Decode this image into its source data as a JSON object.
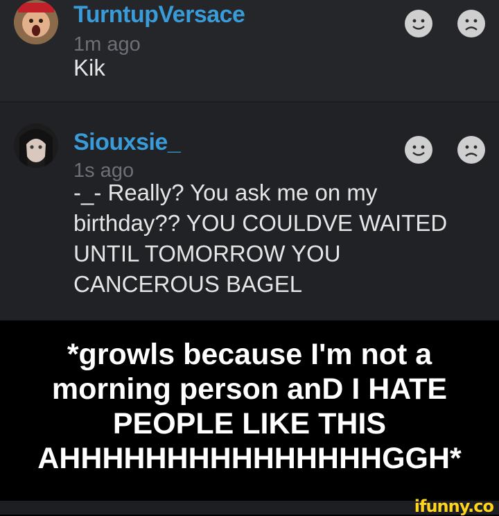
{
  "comments": [
    {
      "username": "TurntupVersace",
      "time": "1m ago",
      "text": "Kik"
    },
    {
      "username": "Siouxsie_",
      "time": "1s ago",
      "text": "-_- Really? You ask me on my birthday?? YOU COULDVE WAITED UNTIL TOMORROW YOU CANCEROUS BAGEL"
    }
  ],
  "caption": {
    "lines": [
      "*growls because I'm not a",
      "morning person anD I HATE",
      "PEOPLE LIKE THIS",
      "AHHHHHHHHHHHHHHHGGH*"
    ]
  },
  "watermark": "ifunny.co",
  "colors": {
    "username": "#3a9bd9",
    "background": "#24262a",
    "caption_bg": "#000000",
    "watermark": "#ffd41b"
  },
  "icons": {
    "like": "smiley-icon",
    "dislike": "frown-icon"
  }
}
